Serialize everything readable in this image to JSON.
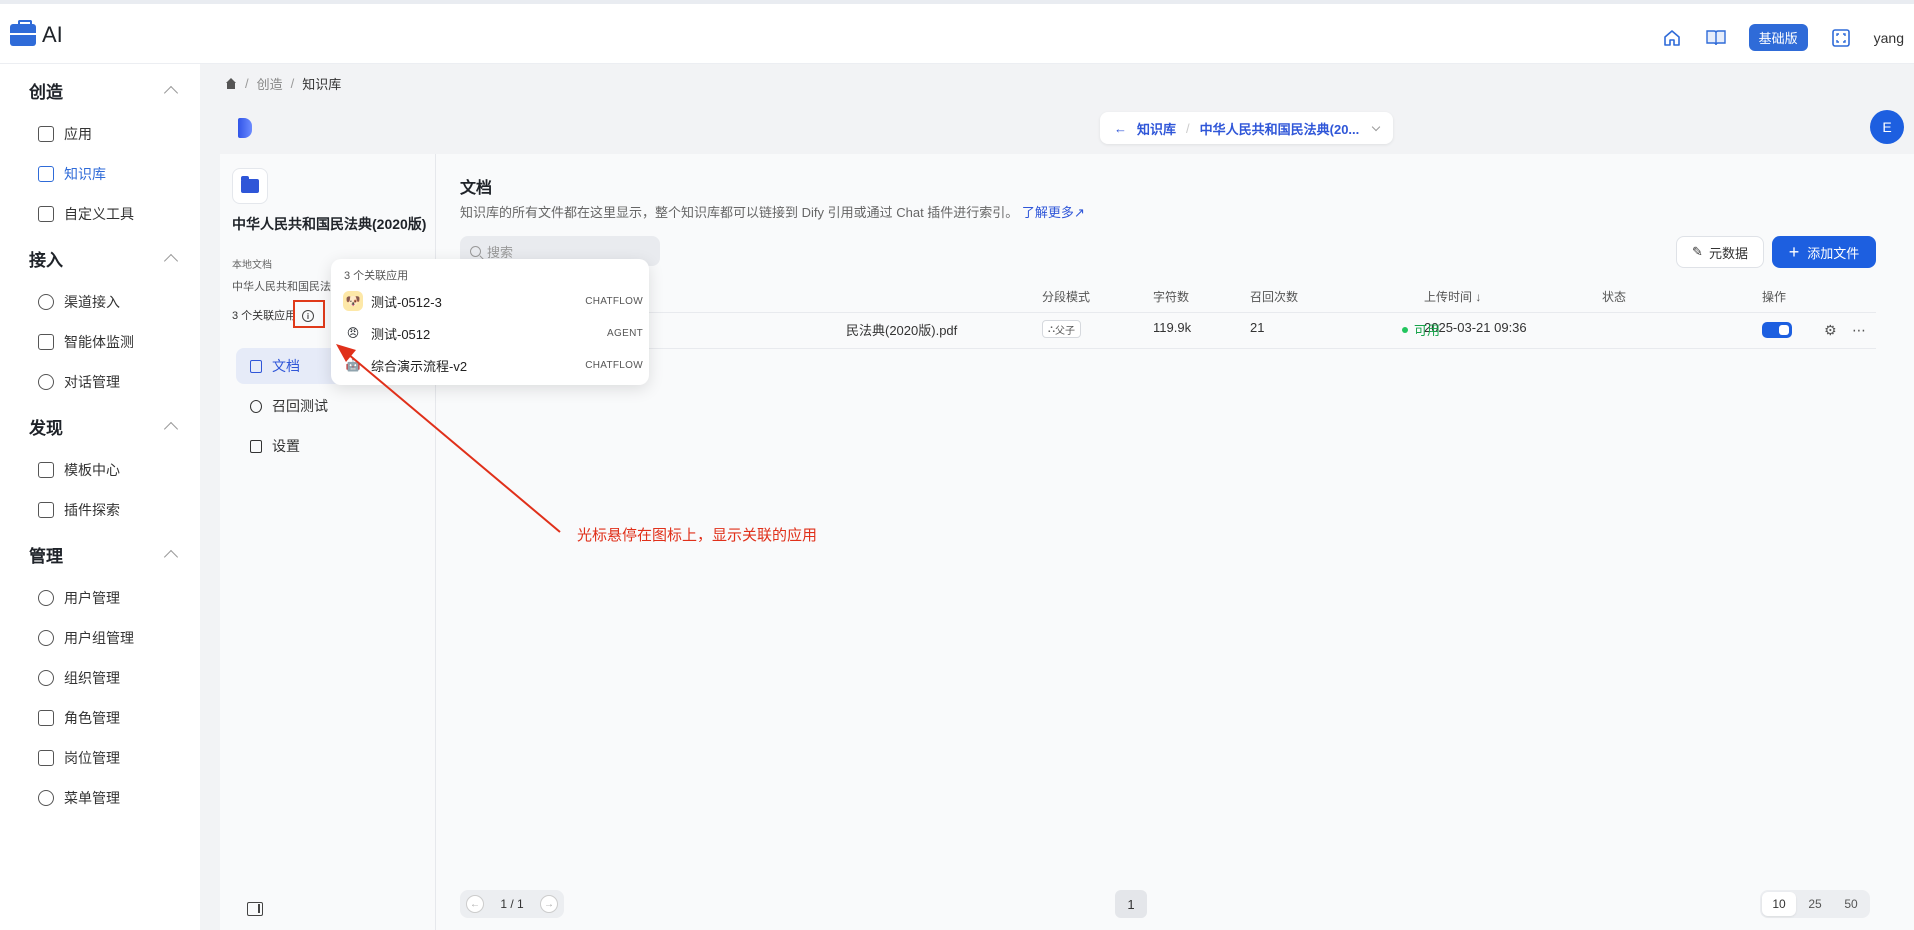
{
  "topbar": {
    "logo_text": "AI",
    "plan_badge": "基础版",
    "user_name": "yang",
    "icons": [
      "home-icon",
      "book-icon",
      "fullscreen-icon"
    ]
  },
  "nav": {
    "groups": [
      {
        "title": "创造",
        "items": [
          {
            "label": "应用",
            "icon": "robot-icon"
          },
          {
            "label": "知识库",
            "icon": "book-icon",
            "active": true
          },
          {
            "label": "自定义工具",
            "icon": "tool-icon"
          }
        ]
      },
      {
        "title": "接入",
        "items": [
          {
            "label": "渠道接入",
            "icon": "link-icon"
          },
          {
            "label": "智能体监测",
            "icon": "monitor-icon"
          },
          {
            "label": "对话管理",
            "icon": "chat-icon"
          }
        ]
      },
      {
        "title": "发现",
        "items": [
          {
            "label": "模板中心",
            "icon": "template-icon"
          },
          {
            "label": "插件探索",
            "icon": "plugin-icon"
          }
        ]
      },
      {
        "title": "管理",
        "items": [
          {
            "label": "用户管理",
            "icon": "user-icon"
          },
          {
            "label": "用户组管理",
            "icon": "user-icon"
          },
          {
            "label": "组织管理",
            "icon": "org-icon"
          },
          {
            "label": "角色管理",
            "icon": "role-icon"
          },
          {
            "label": "岗位管理",
            "icon": "post-icon"
          },
          {
            "label": "菜单管理",
            "icon": "menu-icon"
          }
        ]
      }
    ]
  },
  "breadcrumb": {
    "items": [
      "创造",
      "知识库"
    ]
  },
  "kb_switch": {
    "back_label": "知识库",
    "current": "中华人民共和国民法典(20..."
  },
  "avatar_letter": "E",
  "kb": {
    "name": "中华人民共和国民法典(2020版)",
    "type": "本地文档",
    "desc": "中华人民共和国民法典",
    "linked": "3 个关联应用",
    "tabs": [
      {
        "label": "文档",
        "active": true
      },
      {
        "label": "召回测试"
      },
      {
        "label": "设置"
      }
    ]
  },
  "docs": {
    "title": "文档",
    "desc": "知识库的所有文件都在这里显示，整个知识库都可以链接到 Dify 引用或通过 Chat 插件进行索引。",
    "learn_more": "了解更多",
    "search_placeholder": "搜索",
    "btn_meta": "元数据",
    "btn_add": "添加文件",
    "headers": {
      "segment": "分段模式",
      "chars": "字符数",
      "recall": "召回次数",
      "uploaded": "上传时间",
      "status": "状态",
      "actions": "操作"
    },
    "row": {
      "file_visible": "民法典(2020版).pdf",
      "segment": "父子",
      "chars": "119.9k",
      "recall": "21",
      "uploaded": "2025-03-21 09:36",
      "status": "可用"
    }
  },
  "pagination": {
    "pages": "1 / 1",
    "current": "1",
    "sizes": [
      "10",
      "25",
      "50"
    ],
    "selected_size": "10"
  },
  "popover": {
    "title": "3 个关联应用",
    "apps": [
      {
        "name": "测试-0512-3",
        "mode": "CHATFLOW",
        "emoji": "🐶",
        "bg": "#fde8a8"
      },
      {
        "name": "测试-0512",
        "mode": "AGENT",
        "emoji": "😠",
        "bg": "#ffffff"
      },
      {
        "name": "综合演示流程-v2",
        "mode": "CHATFLOW",
        "emoji": "🤖",
        "bg": "#ffffff"
      }
    ]
  },
  "annotation": {
    "text": "光标悬停在图标上，显示关联的应用",
    "color": "#e0301a"
  },
  "colors": {
    "accent": "#1d5fe0",
    "success": "#16a34a"
  }
}
